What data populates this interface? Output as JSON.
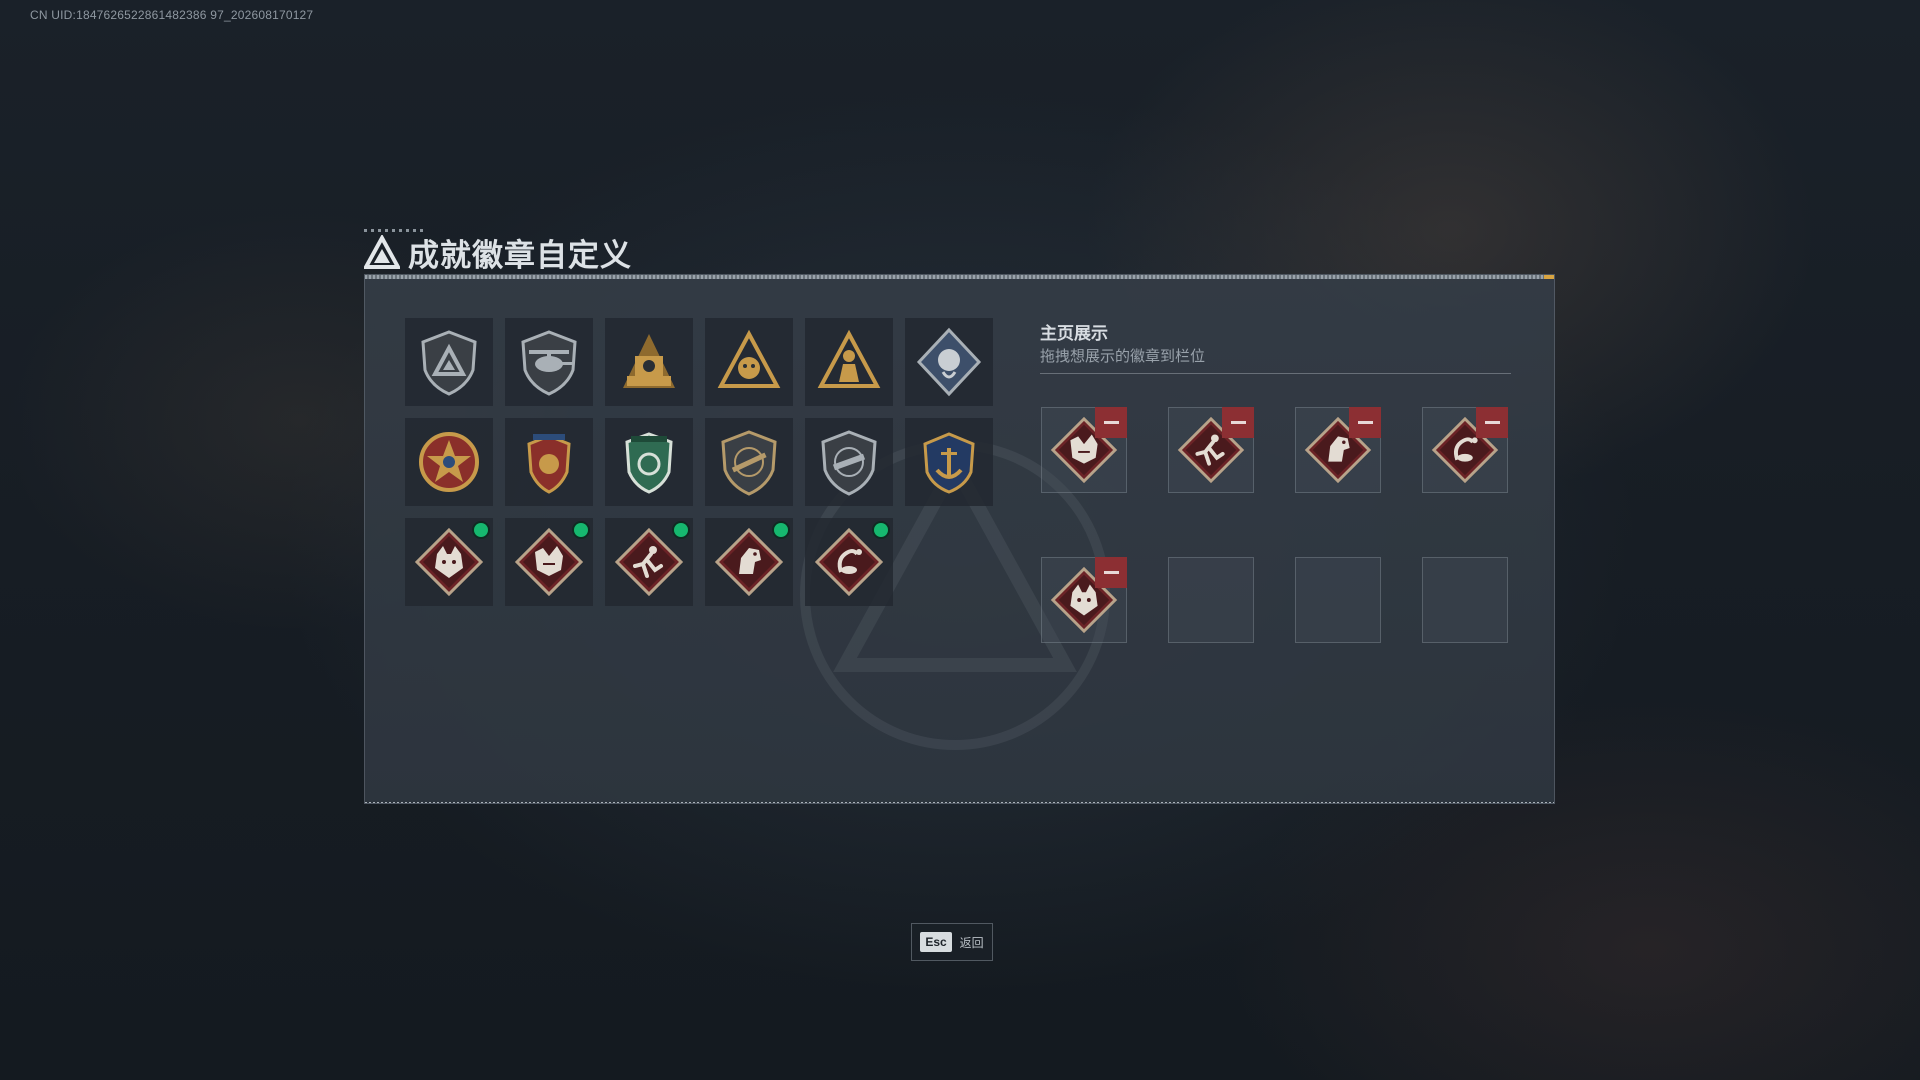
{
  "uid_text": "CN UID:1847626522861482386 97_202608170127",
  "title": "成就徽章自定义",
  "display": {
    "title": "主页展示",
    "subtitle": "拖拽想展示的徽章到栏位"
  },
  "badges": [
    {
      "icon": "shield-delta-icon"
    },
    {
      "icon": "helicopter-shield-icon"
    },
    {
      "icon": "golden-tower-icon"
    },
    {
      "icon": "golden-triangle-beast-icon"
    },
    {
      "icon": "golden-triangle-soldier-icon"
    },
    {
      "icon": "silver-rose-diamond-icon"
    },
    {
      "icon": "star-medal-icon"
    },
    {
      "icon": "winged-shield-medal-icon"
    },
    {
      "icon": "green-shield-icon"
    },
    {
      "icon": "rifle-shield-icon"
    },
    {
      "icon": "smg-shield-icon"
    },
    {
      "icon": "navy-anchor-icon"
    },
    {
      "icon": "wolf-diamond-icon",
      "new": true
    },
    {
      "icon": "dragon-diamond-icon",
      "new": true
    },
    {
      "icon": "runner-diamond-icon",
      "new": true
    },
    {
      "icon": "horse-diamond-icon",
      "new": true
    },
    {
      "icon": "scorpion-diamond-icon",
      "new": true
    }
  ],
  "slots": [
    {
      "icon": "dragon-diamond-icon",
      "filled": true
    },
    {
      "icon": "runner-diamond-icon",
      "filled": true
    },
    {
      "icon": "horse-diamond-icon",
      "filled": true
    },
    {
      "icon": "scorpion-diamond-icon",
      "filled": true
    },
    {
      "icon": "wolf-diamond-icon",
      "filled": true
    },
    {
      "filled": false
    },
    {
      "filled": false
    },
    {
      "filled": false
    }
  ],
  "footer": {
    "key": "Esc",
    "label": "返回"
  },
  "colors": {
    "accent_gold": "#d9a441",
    "new_dot": "#16b86f",
    "remove": "#8c2f33",
    "diamond_red": "#6b2226"
  }
}
